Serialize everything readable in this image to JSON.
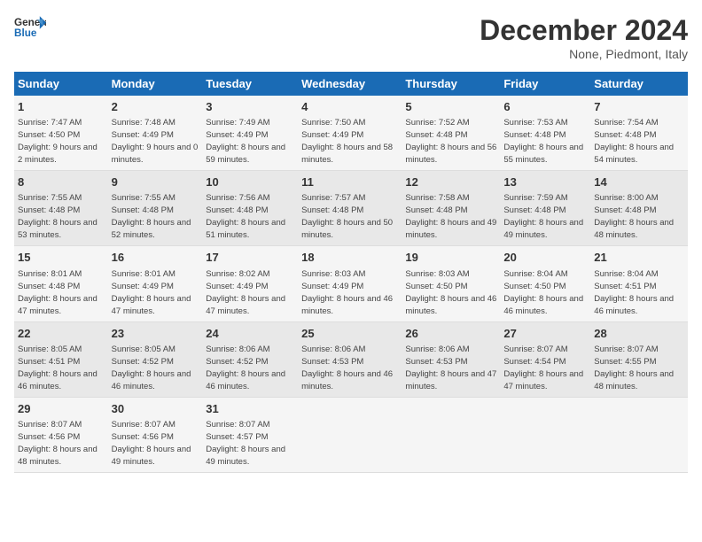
{
  "header": {
    "logo_line1": "General",
    "logo_line2": "Blue",
    "month": "December 2024",
    "location": "None, Piedmont, Italy"
  },
  "days_of_week": [
    "Sunday",
    "Monday",
    "Tuesday",
    "Wednesday",
    "Thursday",
    "Friday",
    "Saturday"
  ],
  "weeks": [
    [
      {
        "day": "1",
        "sunrise": "Sunrise: 7:47 AM",
        "sunset": "Sunset: 4:50 PM",
        "daylight": "Daylight: 9 hours and 2 minutes."
      },
      {
        "day": "2",
        "sunrise": "Sunrise: 7:48 AM",
        "sunset": "Sunset: 4:49 PM",
        "daylight": "Daylight: 9 hours and 0 minutes."
      },
      {
        "day": "3",
        "sunrise": "Sunrise: 7:49 AM",
        "sunset": "Sunset: 4:49 PM",
        "daylight": "Daylight: 8 hours and 59 minutes."
      },
      {
        "day": "4",
        "sunrise": "Sunrise: 7:50 AM",
        "sunset": "Sunset: 4:49 PM",
        "daylight": "Daylight: 8 hours and 58 minutes."
      },
      {
        "day": "5",
        "sunrise": "Sunrise: 7:52 AM",
        "sunset": "Sunset: 4:48 PM",
        "daylight": "Daylight: 8 hours and 56 minutes."
      },
      {
        "day": "6",
        "sunrise": "Sunrise: 7:53 AM",
        "sunset": "Sunset: 4:48 PM",
        "daylight": "Daylight: 8 hours and 55 minutes."
      },
      {
        "day": "7",
        "sunrise": "Sunrise: 7:54 AM",
        "sunset": "Sunset: 4:48 PM",
        "daylight": "Daylight: 8 hours and 54 minutes."
      }
    ],
    [
      {
        "day": "8",
        "sunrise": "Sunrise: 7:55 AM",
        "sunset": "Sunset: 4:48 PM",
        "daylight": "Daylight: 8 hours and 53 minutes."
      },
      {
        "day": "9",
        "sunrise": "Sunrise: 7:55 AM",
        "sunset": "Sunset: 4:48 PM",
        "daylight": "Daylight: 8 hours and 52 minutes."
      },
      {
        "day": "10",
        "sunrise": "Sunrise: 7:56 AM",
        "sunset": "Sunset: 4:48 PM",
        "daylight": "Daylight: 8 hours and 51 minutes."
      },
      {
        "day": "11",
        "sunrise": "Sunrise: 7:57 AM",
        "sunset": "Sunset: 4:48 PM",
        "daylight": "Daylight: 8 hours and 50 minutes."
      },
      {
        "day": "12",
        "sunrise": "Sunrise: 7:58 AM",
        "sunset": "Sunset: 4:48 PM",
        "daylight": "Daylight: 8 hours and 49 minutes."
      },
      {
        "day": "13",
        "sunrise": "Sunrise: 7:59 AM",
        "sunset": "Sunset: 4:48 PM",
        "daylight": "Daylight: 8 hours and 49 minutes."
      },
      {
        "day": "14",
        "sunrise": "Sunrise: 8:00 AM",
        "sunset": "Sunset: 4:48 PM",
        "daylight": "Daylight: 8 hours and 48 minutes."
      }
    ],
    [
      {
        "day": "15",
        "sunrise": "Sunrise: 8:01 AM",
        "sunset": "Sunset: 4:48 PM",
        "daylight": "Daylight: 8 hours and 47 minutes."
      },
      {
        "day": "16",
        "sunrise": "Sunrise: 8:01 AM",
        "sunset": "Sunset: 4:49 PM",
        "daylight": "Daylight: 8 hours and 47 minutes."
      },
      {
        "day": "17",
        "sunrise": "Sunrise: 8:02 AM",
        "sunset": "Sunset: 4:49 PM",
        "daylight": "Daylight: 8 hours and 47 minutes."
      },
      {
        "day": "18",
        "sunrise": "Sunrise: 8:03 AM",
        "sunset": "Sunset: 4:49 PM",
        "daylight": "Daylight: 8 hours and 46 minutes."
      },
      {
        "day": "19",
        "sunrise": "Sunrise: 8:03 AM",
        "sunset": "Sunset: 4:50 PM",
        "daylight": "Daylight: 8 hours and 46 minutes."
      },
      {
        "day": "20",
        "sunrise": "Sunrise: 8:04 AM",
        "sunset": "Sunset: 4:50 PM",
        "daylight": "Daylight: 8 hours and 46 minutes."
      },
      {
        "day": "21",
        "sunrise": "Sunrise: 8:04 AM",
        "sunset": "Sunset: 4:51 PM",
        "daylight": "Daylight: 8 hours and 46 minutes."
      }
    ],
    [
      {
        "day": "22",
        "sunrise": "Sunrise: 8:05 AM",
        "sunset": "Sunset: 4:51 PM",
        "daylight": "Daylight: 8 hours and 46 minutes."
      },
      {
        "day": "23",
        "sunrise": "Sunrise: 8:05 AM",
        "sunset": "Sunset: 4:52 PM",
        "daylight": "Daylight: 8 hours and 46 minutes."
      },
      {
        "day": "24",
        "sunrise": "Sunrise: 8:06 AM",
        "sunset": "Sunset: 4:52 PM",
        "daylight": "Daylight: 8 hours and 46 minutes."
      },
      {
        "day": "25",
        "sunrise": "Sunrise: 8:06 AM",
        "sunset": "Sunset: 4:53 PM",
        "daylight": "Daylight: 8 hours and 46 minutes."
      },
      {
        "day": "26",
        "sunrise": "Sunrise: 8:06 AM",
        "sunset": "Sunset: 4:53 PM",
        "daylight": "Daylight: 8 hours and 47 minutes."
      },
      {
        "day": "27",
        "sunrise": "Sunrise: 8:07 AM",
        "sunset": "Sunset: 4:54 PM",
        "daylight": "Daylight: 8 hours and 47 minutes."
      },
      {
        "day": "28",
        "sunrise": "Sunrise: 8:07 AM",
        "sunset": "Sunset: 4:55 PM",
        "daylight": "Daylight: 8 hours and 48 minutes."
      }
    ],
    [
      {
        "day": "29",
        "sunrise": "Sunrise: 8:07 AM",
        "sunset": "Sunset: 4:56 PM",
        "daylight": "Daylight: 8 hours and 48 minutes."
      },
      {
        "day": "30",
        "sunrise": "Sunrise: 8:07 AM",
        "sunset": "Sunset: 4:56 PM",
        "daylight": "Daylight: 8 hours and 49 minutes."
      },
      {
        "day": "31",
        "sunrise": "Sunrise: 8:07 AM",
        "sunset": "Sunset: 4:57 PM",
        "daylight": "Daylight: 8 hours and 49 minutes."
      },
      {
        "day": "",
        "sunrise": "",
        "sunset": "",
        "daylight": ""
      },
      {
        "day": "",
        "sunrise": "",
        "sunset": "",
        "daylight": ""
      },
      {
        "day": "",
        "sunrise": "",
        "sunset": "",
        "daylight": ""
      },
      {
        "day": "",
        "sunrise": "",
        "sunset": "",
        "daylight": ""
      }
    ]
  ]
}
